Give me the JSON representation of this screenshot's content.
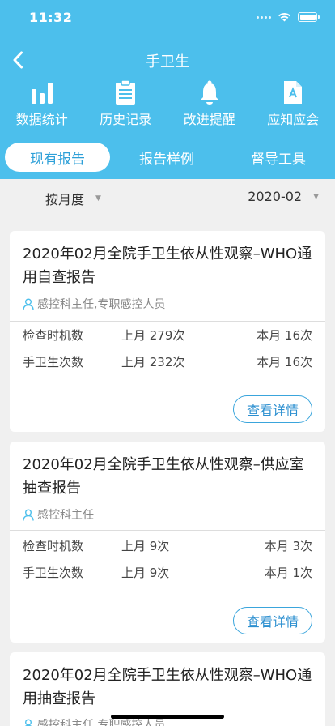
{
  "status_bar": {
    "time": "11:32"
  },
  "nav": {
    "title": "手卫生"
  },
  "quick_menu": [
    {
      "label": "数据统计",
      "icon": "bar-chart-icon"
    },
    {
      "label": "历史记录",
      "icon": "clipboard-icon"
    },
    {
      "label": "改进提醒",
      "icon": "bell-icon"
    },
    {
      "label": "应知应会",
      "icon": "document-a-icon"
    }
  ],
  "tabs": [
    {
      "label": "现有报告",
      "active": true
    },
    {
      "label": "报告样例",
      "active": false
    },
    {
      "label": "督导工具",
      "active": false
    }
  ],
  "filters": {
    "period": "按月度",
    "date": "2020-02"
  },
  "reports": [
    {
      "title": "2020年02月全院手卫生依从性观察–WHO通用自查报告",
      "author": "感控科主任,专职感控人员",
      "stats": [
        {
          "label": "检查时机数",
          "last": "上月 279次",
          "current": "本月 16次"
        },
        {
          "label": "手卫生次数",
          "last": "上月 232次",
          "current": "本月 16次"
        }
      ],
      "button": "查看详情"
    },
    {
      "title": "2020年02月全院手卫生依从性观察–供应室抽查报告",
      "author": "感控科主任",
      "stats": [
        {
          "label": "检查时机数",
          "last": "上月 9次",
          "current": "本月 3次"
        },
        {
          "label": "手卫生次数",
          "last": "上月 9次",
          "current": "本月 1次"
        }
      ],
      "button": "查看详情"
    },
    {
      "title": "2020年02月全院手卫生依从性观察–WHO通用抽查报告",
      "author": "感控科主任,专职感控人员"
    }
  ],
  "colors": {
    "primary": "#4cbfec",
    "accent": "#2b8fd0",
    "background": "#f0f0f0"
  }
}
